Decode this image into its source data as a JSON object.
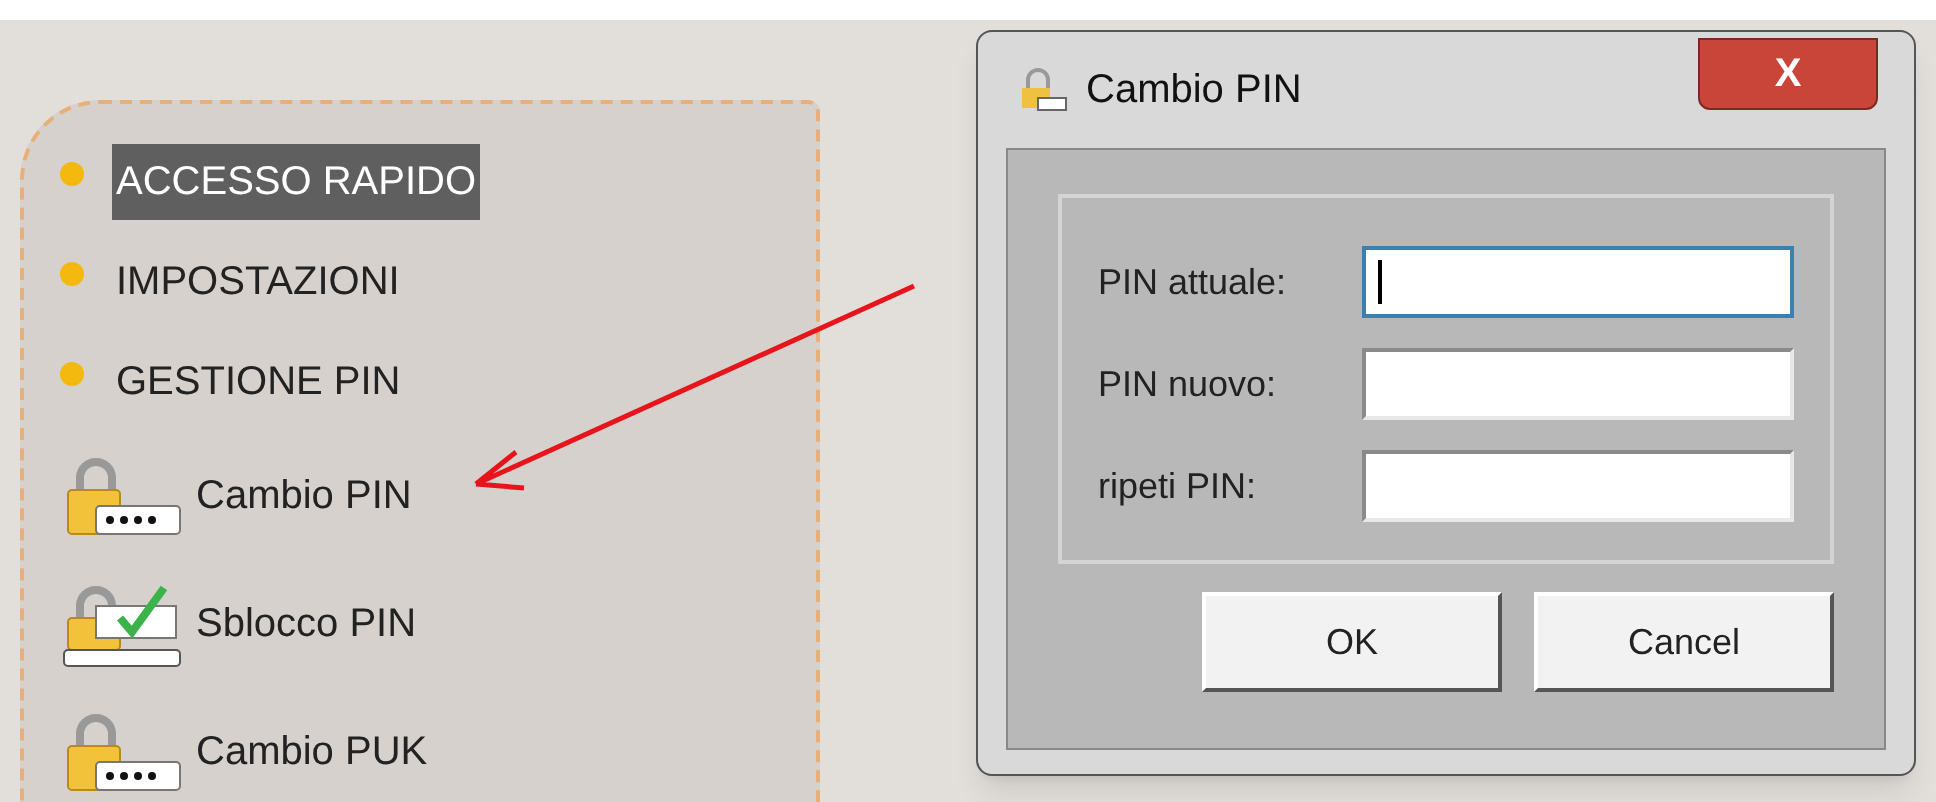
{
  "menu": [
    {
      "kind": "section",
      "label": "ACCESSO RAPIDO",
      "selected": true
    },
    {
      "kind": "section",
      "label": "IMPOSTAZIONI",
      "selected": false
    },
    {
      "kind": "section",
      "label": "GESTIONE PIN",
      "selected": false
    },
    {
      "kind": "change",
      "label": "Cambio PIN",
      "selected": false
    },
    {
      "kind": "unlock",
      "label": "Sblocco PIN",
      "selected": false
    },
    {
      "kind": "change",
      "label": "Cambio PUK",
      "selected": false
    }
  ],
  "dialog": {
    "title": "Cambio PIN",
    "close": "X",
    "fields": [
      {
        "label": "PIN attuale:",
        "focused": true
      },
      {
        "label": "PIN nuovo:",
        "focused": false
      },
      {
        "label": "ripeti PIN:",
        "focused": false
      }
    ],
    "buttons": [
      "OK",
      "Cancel"
    ]
  }
}
